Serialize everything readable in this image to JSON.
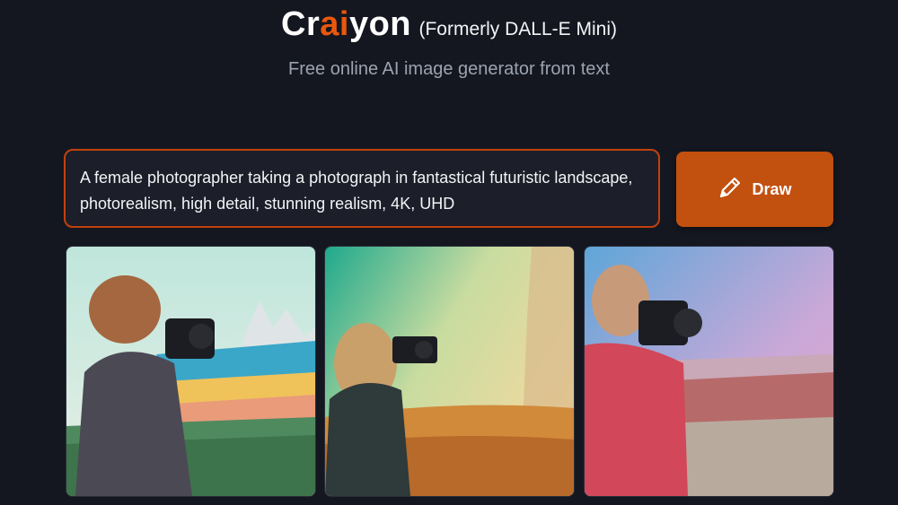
{
  "header": {
    "brand_prefix": "Cr",
    "brand_ai": "ai",
    "brand_suffix": "yon",
    "brand_note": "(Formerly DALL-E Mini)",
    "tagline": "Free online AI image generator from text"
  },
  "prompt": {
    "value": "A female photographer taking a photograph in fantastical futuristic landscape, photorealism, high detail, stunning realism, 4K, UHD"
  },
  "draw_button": {
    "label": "Draw",
    "icon": "pencil-icon"
  },
  "results": [
    {
      "alt": "generated-image-1"
    },
    {
      "alt": "generated-image-2"
    },
    {
      "alt": "generated-image-3"
    }
  ],
  "colors": {
    "background": "#141720",
    "accent": "#ea580c",
    "button": "#c2500f"
  }
}
